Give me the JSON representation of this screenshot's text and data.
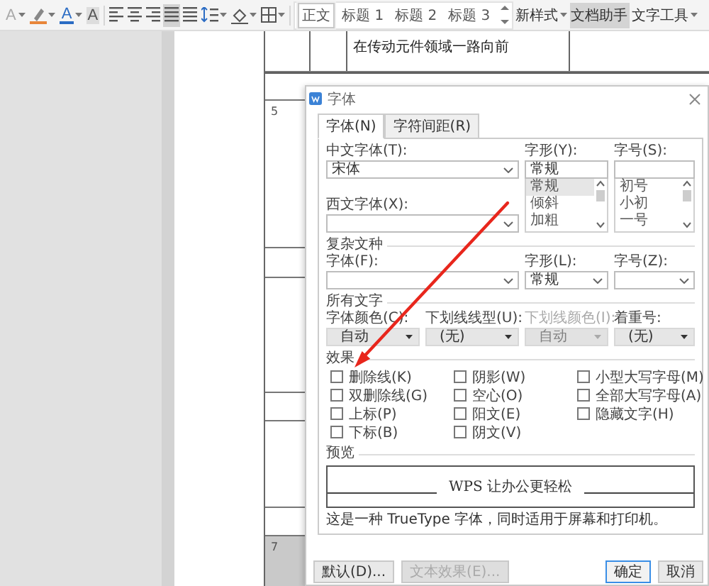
{
  "toolbar": {
    "font_buttons": [
      {
        "kind": "effect",
        "glyph": "A"
      },
      {
        "kind": "highlight"
      },
      {
        "kind": "color",
        "glyph": "A"
      },
      {
        "kind": "shading",
        "glyph": "A"
      }
    ],
    "align_buttons": [
      {
        "kind": "left",
        "selected": false
      },
      {
        "kind": "center",
        "selected": false
      },
      {
        "kind": "right",
        "selected": false
      },
      {
        "kind": "justify",
        "selected": true
      },
      {
        "kind": "distributed",
        "selected": false
      }
    ],
    "styles": [
      {
        "label": "正文",
        "selected": true
      },
      {
        "label": "标题 1",
        "selected": false
      },
      {
        "label": "标题 2",
        "selected": false
      },
      {
        "label": "标题 3",
        "selected": false
      }
    ],
    "buttons": [
      {
        "label": "新样式",
        "selected": false,
        "dropdown": true
      },
      {
        "label": "文档助手",
        "selected": true,
        "dropdown": false
      },
      {
        "label": "文字工具",
        "selected": false,
        "dropdown": true
      }
    ]
  },
  "document": {
    "rows": [
      {
        "text": "在传动元件领域一路向前",
        "shaded": false
      },
      {
        "shaded": false
      },
      {
        "number": "5",
        "shaded": false
      },
      {
        "shaded": false
      },
      {
        "shaded": false
      },
      {
        "shaded": false
      },
      {
        "shaded": false
      },
      {
        "shaded": false
      },
      {
        "number": "7",
        "shaded": true
      }
    ]
  },
  "dialog": {
    "title": "字体",
    "tabs": [
      {
        "label": "字体(N)",
        "selected": true
      },
      {
        "label": "字符间距(R)",
        "selected": false
      }
    ],
    "chinese_font": {
      "label": "中文字体(T):",
      "value": "宋体"
    },
    "style": {
      "label": "字形(Y):",
      "value": "常规",
      "options": [
        {
          "label": "常规",
          "selected": true
        },
        {
          "label": "倾斜",
          "selected": false
        },
        {
          "label": "加粗",
          "selected": false
        }
      ]
    },
    "size": {
      "label": "字号(S):",
      "options": [
        {
          "label": "初号",
          "selected": false
        },
        {
          "label": "小初",
          "selected": false
        },
        {
          "label": "一号",
          "selected": false
        }
      ]
    },
    "western_font": {
      "label": "西文字体(X):"
    },
    "complex_script": {
      "heading": "复杂文种",
      "font": {
        "label": "字体(F):"
      },
      "style": {
        "label": "字形(L):",
        "value": "常规"
      },
      "size": {
        "label": "字号(Z):"
      }
    },
    "all_text": {
      "heading": "所有文字",
      "fields": [
        {
          "label": "字体颜色(C):",
          "value": "自动",
          "disabled": false
        },
        {
          "label": "下划线线型(U):",
          "value": "(无)",
          "disabled": false
        },
        {
          "label": "下划线颜色(I):",
          "value": "自动",
          "disabled": true
        },
        {
          "label": "着重号:",
          "value": "(无)",
          "disabled": false
        }
      ]
    },
    "effects": {
      "heading": "效果",
      "options": [
        {
          "label": "删除线(K)",
          "checked": false
        },
        {
          "label": "双删除线(G)",
          "checked": false
        },
        {
          "label": "上标(P)",
          "checked": false
        },
        {
          "label": "下标(B)",
          "checked": false
        },
        {
          "label": "阴影(W)",
          "checked": false
        },
        {
          "label": "空心(O)",
          "checked": false
        },
        {
          "label": "阳文(E)",
          "checked": false
        },
        {
          "label": "阴文(V)",
          "checked": false
        },
        {
          "label": "小型大写字母(M)",
          "checked": false
        },
        {
          "label": "全部大写字母(A)",
          "checked": false
        },
        {
          "label": "隐藏文字(H)",
          "checked": false
        }
      ]
    },
    "preview": {
      "heading": "预览",
      "sample": "WPS 让办公更轻松",
      "note": "这是一种 TrueType 字体，同时适用于屏幕和打印机。"
    },
    "buttons": [
      {
        "label": "默认(D)...",
        "disabled": false,
        "default": false
      },
      {
        "label": "文本效果(E)...",
        "disabled": true,
        "default": false
      },
      {
        "label": "确定",
        "disabled": false,
        "default": true
      },
      {
        "label": "取消",
        "disabled": false,
        "default": false
      }
    ]
  }
}
